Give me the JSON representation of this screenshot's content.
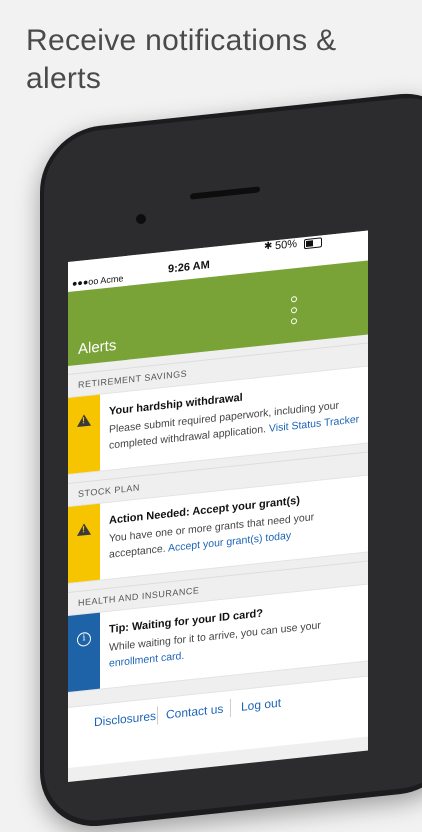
{
  "headline": "Receive notifications & alerts",
  "status_bar": {
    "carrier": "●●●oo Acme",
    "time": "9:26 AM",
    "bluetooth": "✱",
    "battery": "50%"
  },
  "app_bar": {
    "title": "Alerts",
    "menu_icon": "vertical-dots-icon",
    "color": "#7aa337"
  },
  "sections": [
    {
      "header": "RETIREMENT SAVINGS",
      "card": {
        "icon": "warning-icon",
        "stripe_color": "#f7c400",
        "title": "Your hardship withdrawal",
        "text": "Please submit required paperwork, including your completed withdrawal application.",
        "link": "Visit Status Tracker"
      }
    },
    {
      "header": "STOCK PLAN",
      "card": {
        "icon": "warning-icon",
        "stripe_color": "#f7c400",
        "title": "Action Needed: Accept your grant(s)",
        "text": "You have one or more grants that need your acceptance.",
        "link": "Accept your grant(s) today"
      }
    },
    {
      "header": "HEALTH AND INSURANCE",
      "card": {
        "icon": "info-icon",
        "stripe_color": "#1e63a8",
        "title": "Tip: Waiting for your ID card?",
        "text": "While waiting for it to arrive, you can use your",
        "link": "enrollment card."
      }
    }
  ],
  "footer": {
    "disclosures": "Disclosures",
    "contact": "Contact us",
    "logout": "Log out"
  }
}
